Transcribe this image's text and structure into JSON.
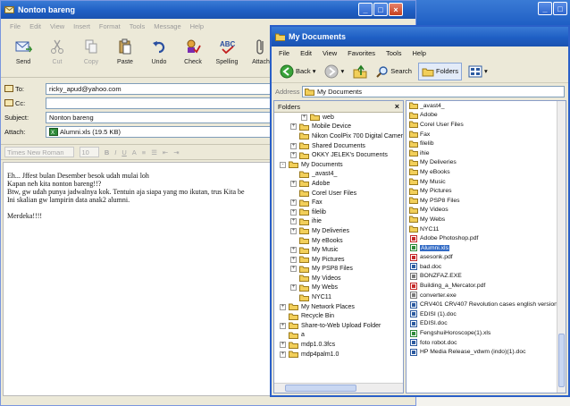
{
  "mail": {
    "title": "Nonton bareng",
    "menu": [
      "File",
      "Edit",
      "View",
      "Insert",
      "Format",
      "Tools",
      "Message",
      "Help"
    ],
    "toolbar": [
      {
        "label": "Send",
        "icon": "send-icon",
        "enabled": true
      },
      {
        "label": "Cut",
        "icon": "cut-icon",
        "enabled": false
      },
      {
        "label": "Copy",
        "icon": "copy-icon",
        "enabled": false
      },
      {
        "label": "Paste",
        "icon": "paste-icon",
        "enabled": true
      },
      {
        "label": "Undo",
        "icon": "undo-icon",
        "enabled": true
      },
      {
        "label": "Check",
        "icon": "check-names-icon",
        "enabled": true
      },
      {
        "label": "Spelling",
        "icon": "spelling-icon",
        "enabled": true
      },
      {
        "label": "Attach",
        "icon": "paperclip-icon",
        "enabled": true
      },
      {
        "label": "P",
        "icon": "priority-icon",
        "enabled": true
      }
    ],
    "to_label": "To:",
    "to_value": "ricky_apud@yahoo.com",
    "cc_label": "Cc:",
    "cc_value": "",
    "subject_label": "Subject:",
    "subject_value": "Nonton bareng",
    "attach_label": "Attach:",
    "attach_value": "Alumni.xls (19.5 KB)",
    "format_bar": {
      "font": "Times New Roman",
      "size": "10"
    },
    "body_lines": [
      "Eh... Jffest bulan Desember besok udah mulai loh",
      "Kapan neh kita nonton bareng!!?",
      "Btw, gw udah punya jadwalnya kok. Tentuin aja siapa yang mo ikutan, trus Kita be",
      "Ini skalian gw lampirin data anak2 alumni.",
      "",
      "Merdeka!!!!"
    ]
  },
  "docs": {
    "title": "My Documents",
    "menu": [
      "File",
      "Edit",
      "View",
      "Favorites",
      "Tools",
      "Help"
    ],
    "nav": {
      "back": "Back",
      "search": "Search",
      "folders": "Folders"
    },
    "address_label": "Address",
    "address_value": "My Documents",
    "folders_header": "Folders",
    "folders_close": "×",
    "tree": [
      {
        "label": "web",
        "indent": 2,
        "expander": "+"
      },
      {
        "label": "Mobile Device",
        "indent": 1,
        "expander": "+"
      },
      {
        "label": "Nikon CoolPix 700 Digital Camera",
        "indent": 1,
        "expander": ""
      },
      {
        "label": "Shared Documents",
        "indent": 1,
        "expander": "+"
      },
      {
        "label": "OKKY JELEK's Documents",
        "indent": 1,
        "expander": "+"
      },
      {
        "label": "My Documents",
        "indent": 0,
        "expander": "-"
      },
      {
        "label": "_avast4_",
        "indent": 1,
        "expander": ""
      },
      {
        "label": "Adobe",
        "indent": 1,
        "expander": "+"
      },
      {
        "label": "Corel User Files",
        "indent": 1,
        "expander": ""
      },
      {
        "label": "Fax",
        "indent": 1,
        "expander": "+"
      },
      {
        "label": "filelib",
        "indent": 1,
        "expander": "+"
      },
      {
        "label": "ihie",
        "indent": 1,
        "expander": "+"
      },
      {
        "label": "My Deliveries",
        "indent": 1,
        "expander": "+"
      },
      {
        "label": "My eBooks",
        "indent": 1,
        "expander": ""
      },
      {
        "label": "My Music",
        "indent": 1,
        "expander": "+"
      },
      {
        "label": "My Pictures",
        "indent": 1,
        "expander": "+"
      },
      {
        "label": "My PSP8 Files",
        "indent": 1,
        "expander": "+"
      },
      {
        "label": "My Videos",
        "indent": 1,
        "expander": ""
      },
      {
        "label": "My Webs",
        "indent": 1,
        "expander": "+"
      },
      {
        "label": "NYC11",
        "indent": 1,
        "expander": ""
      },
      {
        "label": "My Network Places",
        "indent": 0,
        "expander": "+"
      },
      {
        "label": "Recycle Bin",
        "indent": 0,
        "expander": ""
      },
      {
        "label": "Share-to-Web Upload Folder",
        "indent": 0,
        "expander": "+"
      },
      {
        "label": "a",
        "indent": 0,
        "expander": ""
      },
      {
        "label": "mdp1.0.3fcs",
        "indent": 0,
        "expander": "+"
      },
      {
        "label": "mdp4palm1.0",
        "indent": 0,
        "expander": "+"
      }
    ],
    "files": [
      {
        "name": "_avast4_",
        "type": "folder"
      },
      {
        "name": "Adobe",
        "type": "folder"
      },
      {
        "name": "Corel User Files",
        "type": "folder"
      },
      {
        "name": "Fax",
        "type": "folder"
      },
      {
        "name": "filelib",
        "type": "folder"
      },
      {
        "name": "ihie",
        "type": "folder"
      },
      {
        "name": "My Deliveries",
        "type": "folder"
      },
      {
        "name": "My eBooks",
        "type": "folder"
      },
      {
        "name": "My Music",
        "type": "folder"
      },
      {
        "name": "My Pictures",
        "type": "folder"
      },
      {
        "name": "My PSP8 Files",
        "type": "folder"
      },
      {
        "name": "My Videos",
        "type": "folder"
      },
      {
        "name": "My Webs",
        "type": "folder"
      },
      {
        "name": "NYC11",
        "type": "folder"
      },
      {
        "name": "Adobe Photoshop.pdf",
        "type": "pdf"
      },
      {
        "name": "Alumni.xls",
        "type": "xls",
        "selected": true
      },
      {
        "name": "asesonk.pdf",
        "type": "pdf"
      },
      {
        "name": "bad.doc",
        "type": "doc"
      },
      {
        "name": "BONZFAZ.EXE",
        "type": "exe"
      },
      {
        "name": "Building_a_Mercator.pdf",
        "type": "pdf"
      },
      {
        "name": "converter.exe",
        "type": "exe"
      },
      {
        "name": "CRV401 CRV407 Revolution cases english version.pre",
        "type": "doc"
      },
      {
        "name": "EDISI (1).doc",
        "type": "doc"
      },
      {
        "name": "EDISI.doc",
        "type": "doc"
      },
      {
        "name": "FengshuiHoroscope(1).xls",
        "type": "xls"
      },
      {
        "name": "foto robot.doc",
        "type": "doc"
      },
      {
        "name": "HP Media Release_vdwm (indo)(1).doc",
        "type": "doc"
      }
    ]
  }
}
